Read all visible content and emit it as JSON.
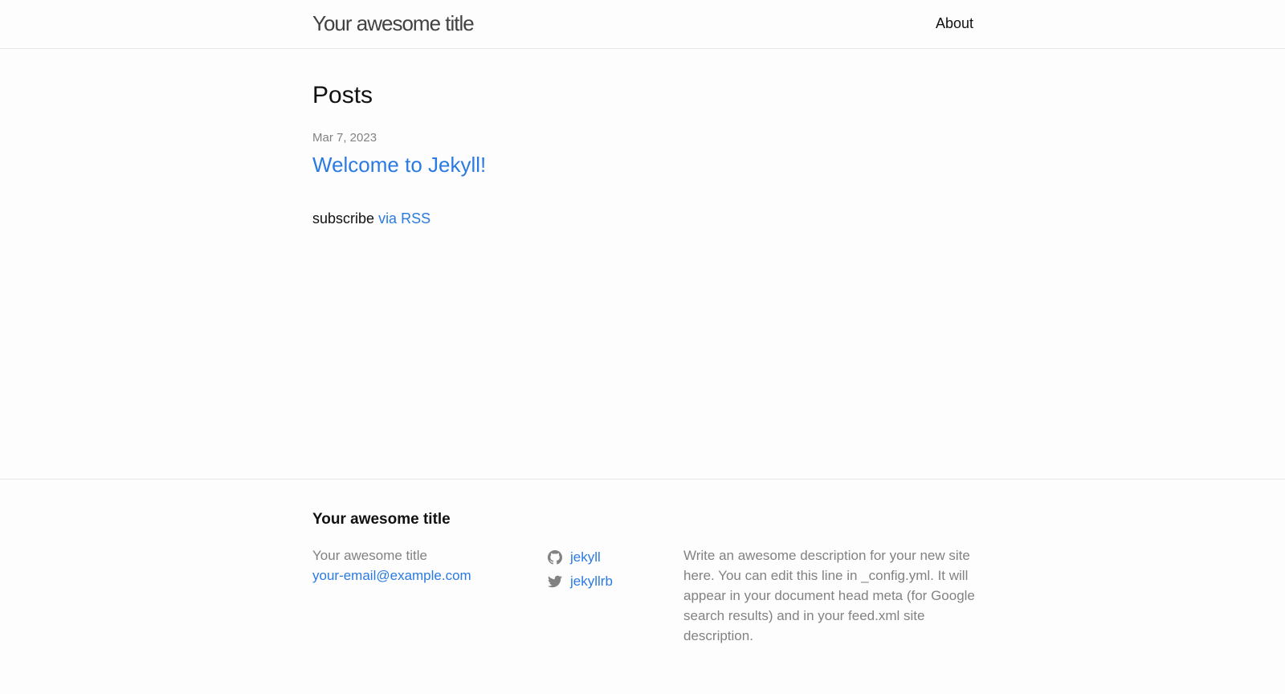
{
  "header": {
    "site_title": "Your awesome title",
    "nav": [
      {
        "label": "About"
      }
    ]
  },
  "main": {
    "heading": "Posts",
    "posts": [
      {
        "date": "Mar 7, 2023",
        "title": "Welcome to Jekyll!"
      }
    ],
    "rss": {
      "prefix": "subscribe",
      "link_label": "via RSS"
    }
  },
  "footer": {
    "heading": "Your awesome title",
    "contact": {
      "name": "Your awesome title",
      "email": "your-email@example.com"
    },
    "social": [
      {
        "icon": "github-icon",
        "username": "jekyll"
      },
      {
        "icon": "twitter-icon",
        "username": "jekyllrb"
      }
    ],
    "description": "Write an awesome description for your new site here. You can edit this line in _config.yml. It will appear in your document head meta (for Google search results) and in your feed.xml site description."
  },
  "colors": {
    "link": "#2a7ae2",
    "text": "#111111",
    "muted": "#828282",
    "border": "#e8e8e8",
    "background": "#fdfdfd"
  }
}
